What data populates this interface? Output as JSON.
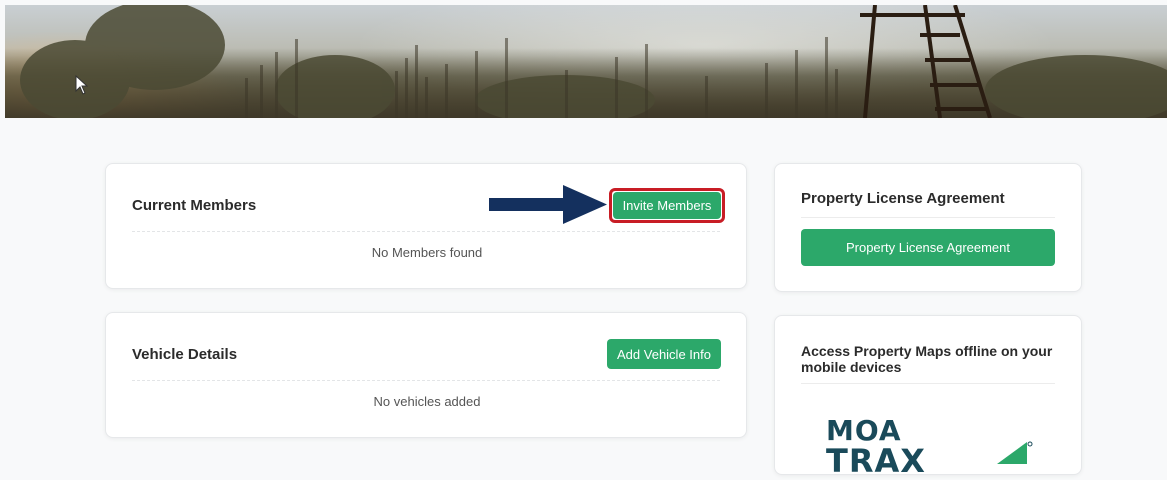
{
  "members": {
    "title": "Current Members",
    "invite_button": "Invite Members",
    "empty_text": "No Members found"
  },
  "vehicles": {
    "title": "Vehicle Details",
    "add_button": "Add Vehicle Info",
    "empty_text": "No vehicles added"
  },
  "license": {
    "title": "Property License Agreement",
    "button": "Property License Agreement"
  },
  "maps": {
    "title": "Access Property Maps offline on your mobile devices",
    "logo_text_top": "MOA",
    "logo_text_bottom": "TRAX"
  },
  "colors": {
    "accent_green": "#2ca86a",
    "highlight_red": "#c81d25",
    "arrow_navy": "#14305e"
  }
}
